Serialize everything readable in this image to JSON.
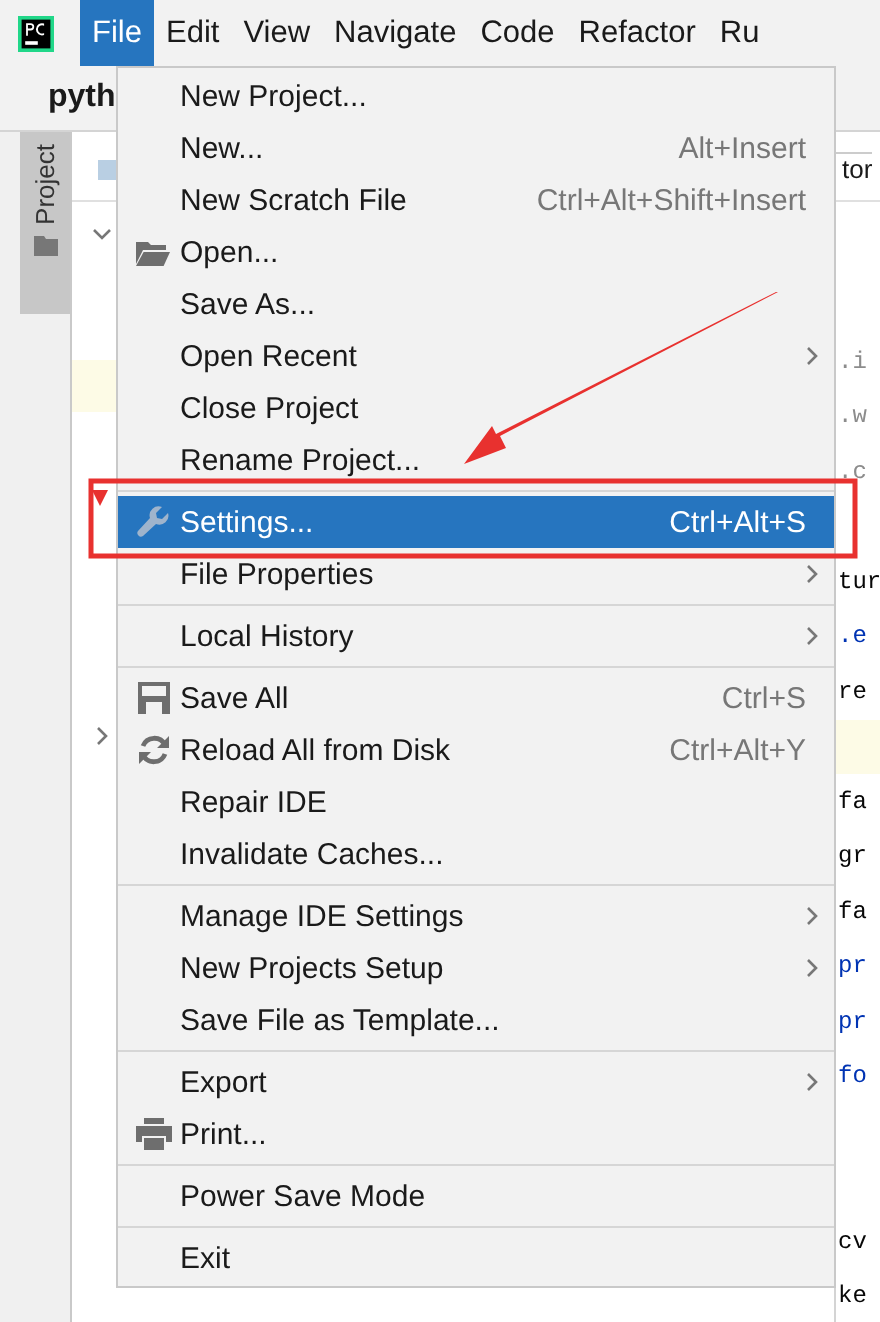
{
  "menubar": [
    {
      "label": "File",
      "selected": true
    },
    {
      "label": "Edit",
      "selected": false
    },
    {
      "label": "View",
      "selected": false
    },
    {
      "label": "Navigate",
      "selected": false
    },
    {
      "label": "Code",
      "selected": false
    },
    {
      "label": "Refactor",
      "selected": false
    },
    {
      "label": "Ru",
      "selected": false
    }
  ],
  "project_title": "pyth",
  "tool_window_tab": "Project",
  "editor": {
    "tab": "tor",
    "lines": [
      {
        "kind": "dim",
        "text": ".i"
      },
      {
        "kind": "dim",
        "text": ".w"
      },
      {
        "kind": "dim",
        "text": ".c"
      },
      {
        "kind": "blank"
      },
      {
        "kind": "plain",
        "text": "tur"
      },
      {
        "kind": "keyword",
        "text": ".e"
      },
      {
        "kind": "plain",
        "text": "re"
      },
      {
        "kind": "current"
      },
      {
        "kind": "plain",
        "text": "fa"
      },
      {
        "kind": "plain",
        "text": "gr"
      },
      {
        "kind": "plain",
        "text": "fa"
      },
      {
        "kind": "keyword",
        "text": "pr"
      },
      {
        "kind": "keyword",
        "text": "pr"
      },
      {
        "kind": "keyword",
        "text": "fo"
      },
      {
        "kind": "blank"
      },
      {
        "kind": "blank"
      },
      {
        "kind": "plain",
        "text": "cv"
      },
      {
        "kind": "plain",
        "text": "ke"
      }
    ]
  },
  "menu": {
    "groups": [
      [
        {
          "label": "New Project...",
          "kind": "plain",
          "submenu": false,
          "selected": false
        },
        {
          "label": "New...",
          "shortcut": "Alt+Insert",
          "kind": "plain",
          "submenu": false,
          "selected": false
        },
        {
          "label": "New Scratch File",
          "shortcut": "Ctrl+Alt+Shift+Insert",
          "kind": "plain",
          "submenu": false,
          "selected": false
        },
        {
          "label": "Open...",
          "kind": "open",
          "submenu": false,
          "selected": false
        },
        {
          "label": "Save As...",
          "kind": "plain",
          "submenu": false,
          "selected": false
        },
        {
          "label": "Open Recent",
          "kind": "plain",
          "submenu": true,
          "selected": false
        },
        {
          "label": "Close Project",
          "kind": "plain",
          "submenu": false,
          "selected": false
        },
        {
          "label": "Rename Project...",
          "kind": "plain",
          "submenu": false,
          "selected": false
        }
      ],
      [
        {
          "label": "Settings...",
          "shortcut": "Ctrl+Alt+S",
          "kind": "settings",
          "submenu": false,
          "selected": true
        },
        {
          "label": "File Properties",
          "kind": "plain",
          "submenu": true,
          "selected": false
        }
      ],
      [
        {
          "label": "Local History",
          "kind": "plain",
          "submenu": true,
          "selected": false
        }
      ],
      [
        {
          "label": "Save All",
          "shortcut": "Ctrl+S",
          "kind": "save",
          "submenu": false,
          "selected": false
        },
        {
          "label": "Reload All from Disk",
          "shortcut": "Ctrl+Alt+Y",
          "kind": "reload",
          "submenu": false,
          "selected": false
        },
        {
          "label": "Repair IDE",
          "kind": "plain",
          "submenu": false,
          "selected": false
        },
        {
          "label": "Invalidate Caches...",
          "kind": "plain",
          "submenu": false,
          "selected": false
        }
      ],
      [
        {
          "label": "Manage IDE Settings",
          "kind": "plain",
          "submenu": true,
          "selected": false
        },
        {
          "label": "New Projects Setup",
          "kind": "plain",
          "submenu": true,
          "selected": false
        },
        {
          "label": "Save File as Template...",
          "kind": "plain",
          "submenu": false,
          "selected": false
        }
      ],
      [
        {
          "label": "Export",
          "kind": "plain",
          "submenu": true,
          "selected": false
        },
        {
          "label": "Print...",
          "kind": "print",
          "submenu": false,
          "selected": false
        }
      ],
      [
        {
          "label": "Power Save Mode",
          "kind": "plain",
          "submenu": false,
          "selected": false
        }
      ],
      [
        {
          "label": "Exit",
          "kind": "plain",
          "submenu": false,
          "selected": false
        }
      ]
    ]
  }
}
